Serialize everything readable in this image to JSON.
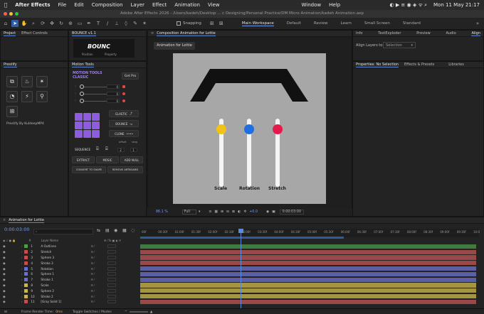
{
  "menubar": {
    "app_name": "After Effects",
    "items": [
      "File",
      "Edit",
      "Composition",
      "Layer",
      "Effect",
      "Animation",
      "View",
      "Window",
      "Help"
    ],
    "datetime": "Mon 11 May  21:17"
  },
  "window_title": "Adobe After Effects 2026 - /Users/kadeh/Desktop ... c Designing/Personal Practice/DM Micro Animation/kadeh Animation.aep",
  "toolbar": {
    "snapping_label": "Snapping",
    "workspaces": [
      "Main Workspace",
      "Default",
      "Review",
      "Learn",
      "Small Screen",
      "Standard"
    ]
  },
  "project_panel": {
    "tabs": [
      "Project",
      "Effect Controls"
    ],
    "bounce_tab": "BOUNCE v1.1"
  },
  "bounce": {
    "logo": "BOUNC",
    "sub_tabs": [
      "Position",
      "Property"
    ]
  },
  "prestify": {
    "title": "Prestify",
    "footer": "Prestify By KuldeepMP4"
  },
  "motion_tools": {
    "title": "Motion Tools",
    "brand_line1": "MOTION TOOLS",
    "brand_line2": "CLASSIC",
    "get_pro": "Get Pro",
    "values": [
      "0",
      "0",
      "0"
    ],
    "elastic": "ELASTIC",
    "bounce": "BOUNCE",
    "clone": "CLONE",
    "offset_label": "offset",
    "step_label": "step",
    "sequence": "SEQUENCE",
    "offset_value": "2",
    "step_value": "1",
    "extract": "EXTRACT",
    "mosic": "MOSIC",
    "add_null": "ADD NULL",
    "convert_to_shape": "CONVERT TO SHAPE",
    "remove_artboard": "REMOVE ARTBOARD"
  },
  "composition": {
    "panel_title": "Composition Animation for Lottie",
    "tab_label": "Animation for Lottie",
    "slider_labels": [
      "Scale",
      "Rotation",
      "Stretch"
    ],
    "zoom": "86.1 %",
    "quality": "Full",
    "exposure": "+0.0",
    "timecode": "0:00:03:00"
  },
  "colors": {
    "knob_yellow": "#f0c21a",
    "knob_blue": "#1f6fe0",
    "knob_red": "#e31a4b",
    "motion_purple": "#8d5ce0",
    "selection_blue": "#2d5ea6"
  },
  "right_panel": {
    "tabs_top": [
      "Info",
      "TextExploder",
      "Preview",
      "Audio",
      "Align"
    ],
    "align_layers_to": "Align Layers to:",
    "align_option": "Selection",
    "tabs_mid": [
      "Properties: No Selection",
      "Effects & Presets",
      "Libraries"
    ]
  },
  "timeline": {
    "tab_label": "Animation for Lottie",
    "timecode": "0:00:03:00",
    "search_placeholder": "",
    "layer_name_header": "Layer Name",
    "ruler": [
      "00f",
      "00:30f",
      "01:00f",
      "01:30f",
      "02:00f",
      "02:30f",
      "03:00f",
      "03:30f",
      "04:00f",
      "04:30f",
      "05:00f",
      "05:30f",
      "06:00f",
      "06:30f",
      "07:00f",
      "07:30f",
      "08:00f",
      "08:30f",
      "09:00f",
      "09:30f",
      "10:0"
    ],
    "layers": [
      {
        "num": "1",
        "name": "A Outlines",
        "color": "#4f9c4f",
        "bar": "#3f7a3f"
      },
      {
        "num": "2",
        "name": "Stretch",
        "color": "#c05050",
        "bar": "#9b4848"
      },
      {
        "num": "3",
        "name": "Sphere 3",
        "color": "#c05050",
        "bar": "#9b4848"
      },
      {
        "num": "4",
        "name": "Stroke 3",
        "color": "#c05050",
        "bar": "#9b4848"
      },
      {
        "num": "5",
        "name": "Rotation",
        "color": "#6a6fc9",
        "bar": "#5a5fa6"
      },
      {
        "num": "6",
        "name": "Sphere 1",
        "color": "#6a6fc9",
        "bar": "#5a5fa6"
      },
      {
        "num": "7",
        "name": "Stroke 1",
        "color": "#6a6fc9",
        "bar": "#5a5fa6"
      },
      {
        "num": "8",
        "name": "Scale",
        "color": "#c9b44f",
        "bar": "#a3963f"
      },
      {
        "num": "9",
        "name": "Sphere 2",
        "color": "#c9b44f",
        "bar": "#a3963f"
      },
      {
        "num": "10",
        "name": "Stroke 2",
        "color": "#c9b44f",
        "bar": "#a3963f"
      },
      {
        "num": "11",
        "name": "[Gray Solid 1]",
        "color": "#c05050",
        "bar": "#9b4848"
      }
    ],
    "footer_render": "Frame Render Time:",
    "footer_ms": "0ms",
    "footer_toggle": "Toggle Switches / Modes"
  }
}
